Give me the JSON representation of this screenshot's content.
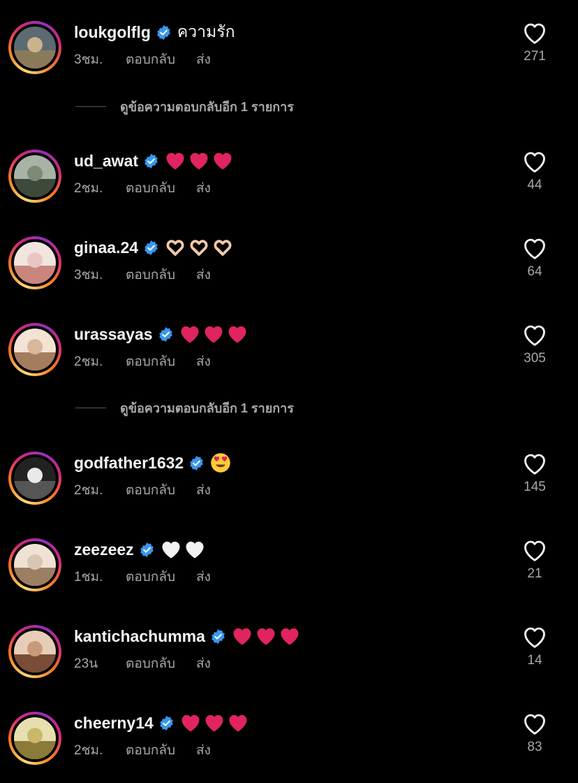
{
  "comments": [
    {
      "username": "loukgolflg",
      "text": "ความรัก",
      "emoji": "",
      "emoji_count": 0,
      "time": "3ชม.",
      "likes": "271"
    },
    {
      "username": "ud_awat",
      "text": "",
      "emoji": "red-heart",
      "emoji_count": 3,
      "time": "2ชม.",
      "likes": "44"
    },
    {
      "username": "ginaa.24",
      "text": "",
      "emoji": "heart-hands",
      "emoji_count": 3,
      "time": "3ชม.",
      "likes": "64"
    },
    {
      "username": "urassayas",
      "text": "",
      "emoji": "red-heart",
      "emoji_count": 3,
      "time": "2ชม.",
      "likes": "305"
    },
    {
      "username": "godfather1632",
      "text": "",
      "emoji": "heart-eyes",
      "emoji_count": 1,
      "time": "2ชม.",
      "likes": "145"
    },
    {
      "username": "zeezeez",
      "text": "",
      "emoji": "white-heart",
      "emoji_count": 2,
      "time": "1ชม.",
      "likes": "21"
    },
    {
      "username": "kantichachumma",
      "text": "",
      "emoji": "red-heart",
      "emoji_count": 3,
      "time": "23น",
      "likes": "14"
    },
    {
      "username": "cheerny14",
      "text": "",
      "emoji": "red-heart",
      "emoji_count": 3,
      "time": "2ชม.",
      "likes": "83"
    }
  ],
  "labels": {
    "reply": "ตอบกลับ",
    "send": "ส่ง",
    "view_more_replies": "ดูข้อความตอบกลับอีก 1 รายการ"
  },
  "colors": {
    "background": "#000000",
    "verified": "#3897f0",
    "secondary_text": "#a8a8a8",
    "red_heart": "#e0245e"
  }
}
